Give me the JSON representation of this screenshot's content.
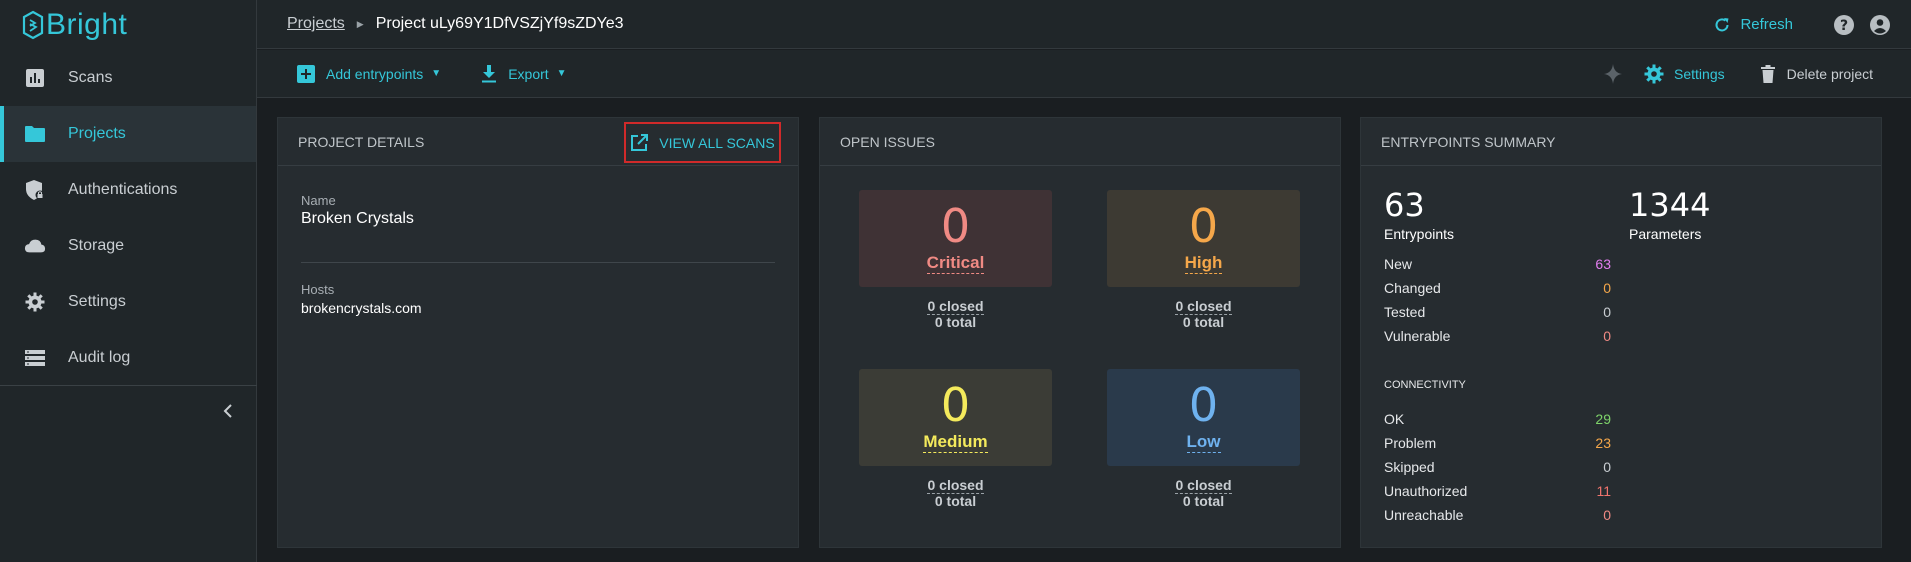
{
  "app": {
    "name": "Bright"
  },
  "sidebar": {
    "items": [
      {
        "label": "Scans",
        "icon": "bar-chart-icon"
      },
      {
        "label": "Projects",
        "icon": "folder-icon",
        "active": true
      },
      {
        "label": "Authentications",
        "icon": "shield-lock-icon"
      },
      {
        "label": "Storage",
        "icon": "cloud-icon"
      },
      {
        "label": "Settings",
        "icon": "gear-icon"
      },
      {
        "label": "Audit log",
        "icon": "list-icon"
      }
    ]
  },
  "breadcrumb": {
    "parent": "Projects",
    "current": "Project uLy69Y1DfVSZjYf9sZDYe3"
  },
  "header": {
    "refresh_label": "Refresh"
  },
  "toolbar": {
    "add_entrypoints_label": "Add entrypoints",
    "export_label": "Export",
    "settings_label": "Settings",
    "delete_label": "Delete project"
  },
  "project_details": {
    "title": "PROJECT DETAILS",
    "view_all_label": "View all scans",
    "name_label": "Name",
    "name_value": "Broken Crystals",
    "hosts_label": "Hosts",
    "hosts_value": "brokencrystals.com"
  },
  "open_issues": {
    "title": "OPEN ISSUES",
    "severities": [
      {
        "label": "Critical",
        "count": "0",
        "closed": "0 closed",
        "total": "0 total",
        "color": "#f08a84",
        "bg": "#3f3235"
      },
      {
        "label": "High",
        "count": "0",
        "closed": "0 closed",
        "total": "0 total",
        "color": "#f5a74a",
        "bg": "#3d3a33"
      },
      {
        "label": "Medium",
        "count": "0",
        "closed": "0 closed",
        "total": "0 total",
        "color": "#f4ea5c",
        "bg": "#3b3c36"
      },
      {
        "label": "Low",
        "count": "0",
        "closed": "0 closed",
        "total": "0 total",
        "color": "#6fb2ef",
        "bg": "#2a3a4b"
      }
    ]
  },
  "entrypoints_summary": {
    "title": "ENTRYPOINTS SUMMARY",
    "entrypoints_count": "63",
    "entrypoints_label": "Entrypoints",
    "parameters_count": "1344",
    "parameters_label": "Parameters",
    "status_rows": [
      {
        "label": "New",
        "value": "63",
        "color": "#e37ef0"
      },
      {
        "label": "Changed",
        "value": "0",
        "color": "#f5a74a"
      },
      {
        "label": "Tested",
        "value": "0",
        "color": "#c9ced2"
      },
      {
        "label": "Vulnerable",
        "value": "0",
        "color": "#f08a84"
      }
    ],
    "connectivity_title": "CONNECTIVITY",
    "connectivity_rows": [
      {
        "label": "OK",
        "value": "29",
        "color": "#7ed36a"
      },
      {
        "label": "Problem",
        "value": "23",
        "color": "#f5a74a"
      },
      {
        "label": "Skipped",
        "value": "0",
        "color": "#c9ced2"
      },
      {
        "label": "Unauthorized",
        "value": "11",
        "color": "#f0746e"
      },
      {
        "label": "Unreachable",
        "value": "0",
        "color": "#f08a84"
      }
    ]
  },
  "colors": {
    "accent": "#35c7d9",
    "background": "#1a1e21",
    "panel": "#262c30",
    "highlight_border": "#d02a2a"
  }
}
